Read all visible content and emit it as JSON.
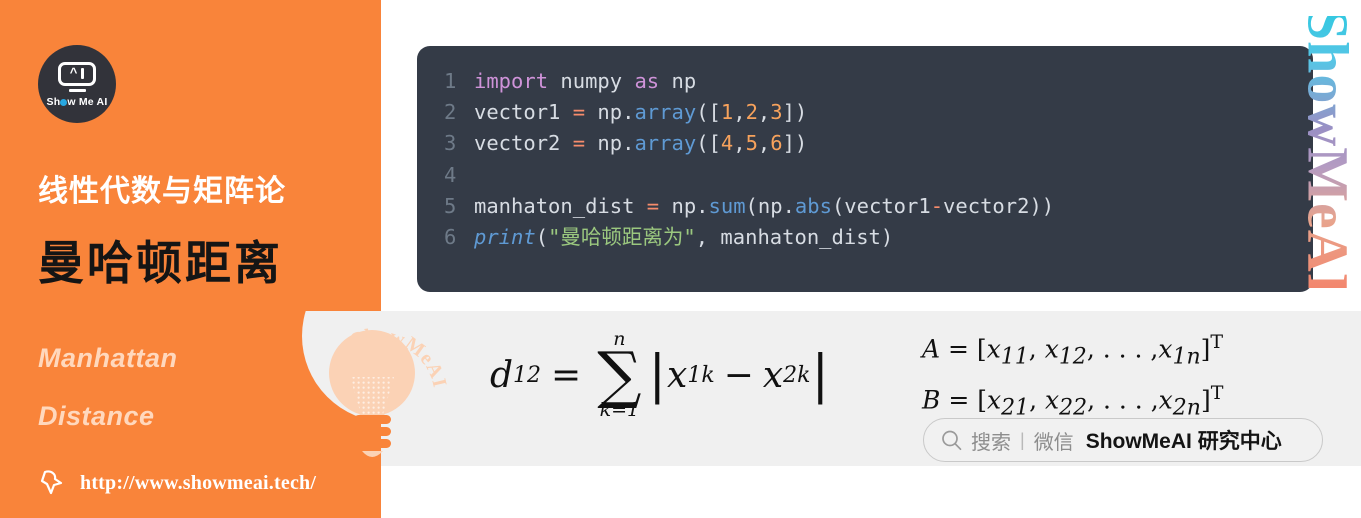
{
  "colors": {
    "orange": "#f9843a",
    "code_bg": "#343b47",
    "panel_gray": "#f0f0f0",
    "logo_dark": "#32333a",
    "en_title": "#ffd8bd",
    "accent_blue": "#28a7e0"
  },
  "left_panel": {
    "logo": {
      "icon_name": "show-me-ai-robot-logo",
      "wordmark_before": "Sh",
      "wordmark_after": "w Me AI"
    },
    "subject_title": "线性代数与矩阵论",
    "main_title": "曼哈顿距离",
    "english_title_line1": "Manhattan",
    "english_title_line2": "Distance",
    "url": "http://www.showmeai.tech/"
  },
  "code_block": {
    "lines": [
      {
        "number": "1",
        "tokens": [
          {
            "t": "import",
            "c": "kw"
          },
          {
            "t": " numpy ",
            "c": "plain"
          },
          {
            "t": "as",
            "c": "kw"
          },
          {
            "t": " np",
            "c": "plain"
          }
        ]
      },
      {
        "number": "2",
        "tokens": [
          {
            "t": "vector1 ",
            "c": "plain"
          },
          {
            "t": "=",
            "c": "op"
          },
          {
            "t": " np.",
            "c": "plain"
          },
          {
            "t": "array",
            "c": "fn"
          },
          {
            "t": "([",
            "c": "punct"
          },
          {
            "t": "1",
            "c": "num"
          },
          {
            "t": ",",
            "c": "punct"
          },
          {
            "t": "2",
            "c": "num"
          },
          {
            "t": ",",
            "c": "punct"
          },
          {
            "t": "3",
            "c": "num"
          },
          {
            "t": "])",
            "c": "punct"
          }
        ]
      },
      {
        "number": "3",
        "tokens": [
          {
            "t": "vector2 ",
            "c": "plain"
          },
          {
            "t": "=",
            "c": "op"
          },
          {
            "t": " np.",
            "c": "plain"
          },
          {
            "t": "array",
            "c": "fn"
          },
          {
            "t": "([",
            "c": "punct"
          },
          {
            "t": "4",
            "c": "num"
          },
          {
            "t": ",",
            "c": "punct"
          },
          {
            "t": "5",
            "c": "num"
          },
          {
            "t": ",",
            "c": "punct"
          },
          {
            "t": "6",
            "c": "num"
          },
          {
            "t": "])",
            "c": "punct"
          }
        ]
      },
      {
        "number": "4",
        "tokens": []
      },
      {
        "number": "5",
        "tokens": [
          {
            "t": "manhaton_dist ",
            "c": "plain"
          },
          {
            "t": "=",
            "c": "op"
          },
          {
            "t": " np.",
            "c": "plain"
          },
          {
            "t": "sum",
            "c": "fn"
          },
          {
            "t": "(np.",
            "c": "plain"
          },
          {
            "t": "abs",
            "c": "fn"
          },
          {
            "t": "(vector1",
            "c": "plain"
          },
          {
            "t": "-",
            "c": "op"
          },
          {
            "t": "vector2))",
            "c": "plain"
          }
        ]
      },
      {
        "number": "6",
        "tokens": [
          {
            "t": "print",
            "c": "print"
          },
          {
            "t": "(",
            "c": "punct"
          },
          {
            "t": "\"曼哈顿距离为\"",
            "c": "str"
          },
          {
            "t": ", manhaton_dist)",
            "c": "plain"
          }
        ]
      }
    ]
  },
  "watermarks": {
    "vertical_text": "ShowMeAI",
    "bulb_curved_text": "ShowMeAI",
    "bulb_icon_name": "lightbulb-icon"
  },
  "formula": {
    "main": {
      "lhs_var": "d",
      "lhs_sub": "12",
      "equals": "=",
      "sum_upper": "n",
      "sum_symbol": "∑",
      "sum_lower": "k=1",
      "bar_open": "|",
      "term1_var": "x",
      "term1_sub": "1k",
      "minus": "−",
      "term2_var": "x",
      "term2_sub": "2k",
      "bar_close": "|"
    },
    "vector_a": "A = [x₁₁, x₁₂, . . . , x₁ₙ]ᵀ",
    "vector_b": "B = [x₂₁, x₂₂, . . . , x₂ₙ]ᵀ",
    "vector_a_parts": {
      "name": "A",
      "eq": "=",
      "open": "[",
      "e1": "x",
      "e1s": "11",
      "e2": "x",
      "e2s": "12",
      "dots": ", . . . ,",
      "e3": "x",
      "e3s": "1n",
      "close": "]",
      "sup": "T"
    },
    "vector_b_parts": {
      "name": "B",
      "eq": "=",
      "open": "[",
      "e1": "x",
      "e1s": "21",
      "e2": "x",
      "e2s": "22",
      "dots": ", . . . ,",
      "e3": "x",
      "e3s": "2n",
      "close": "]",
      "sup": "T"
    }
  },
  "search_pill": {
    "icon_name": "search-icon",
    "label": "搜索",
    "separator": "|",
    "platform": "微信",
    "brand": "ShowMeAI 研究中心"
  }
}
